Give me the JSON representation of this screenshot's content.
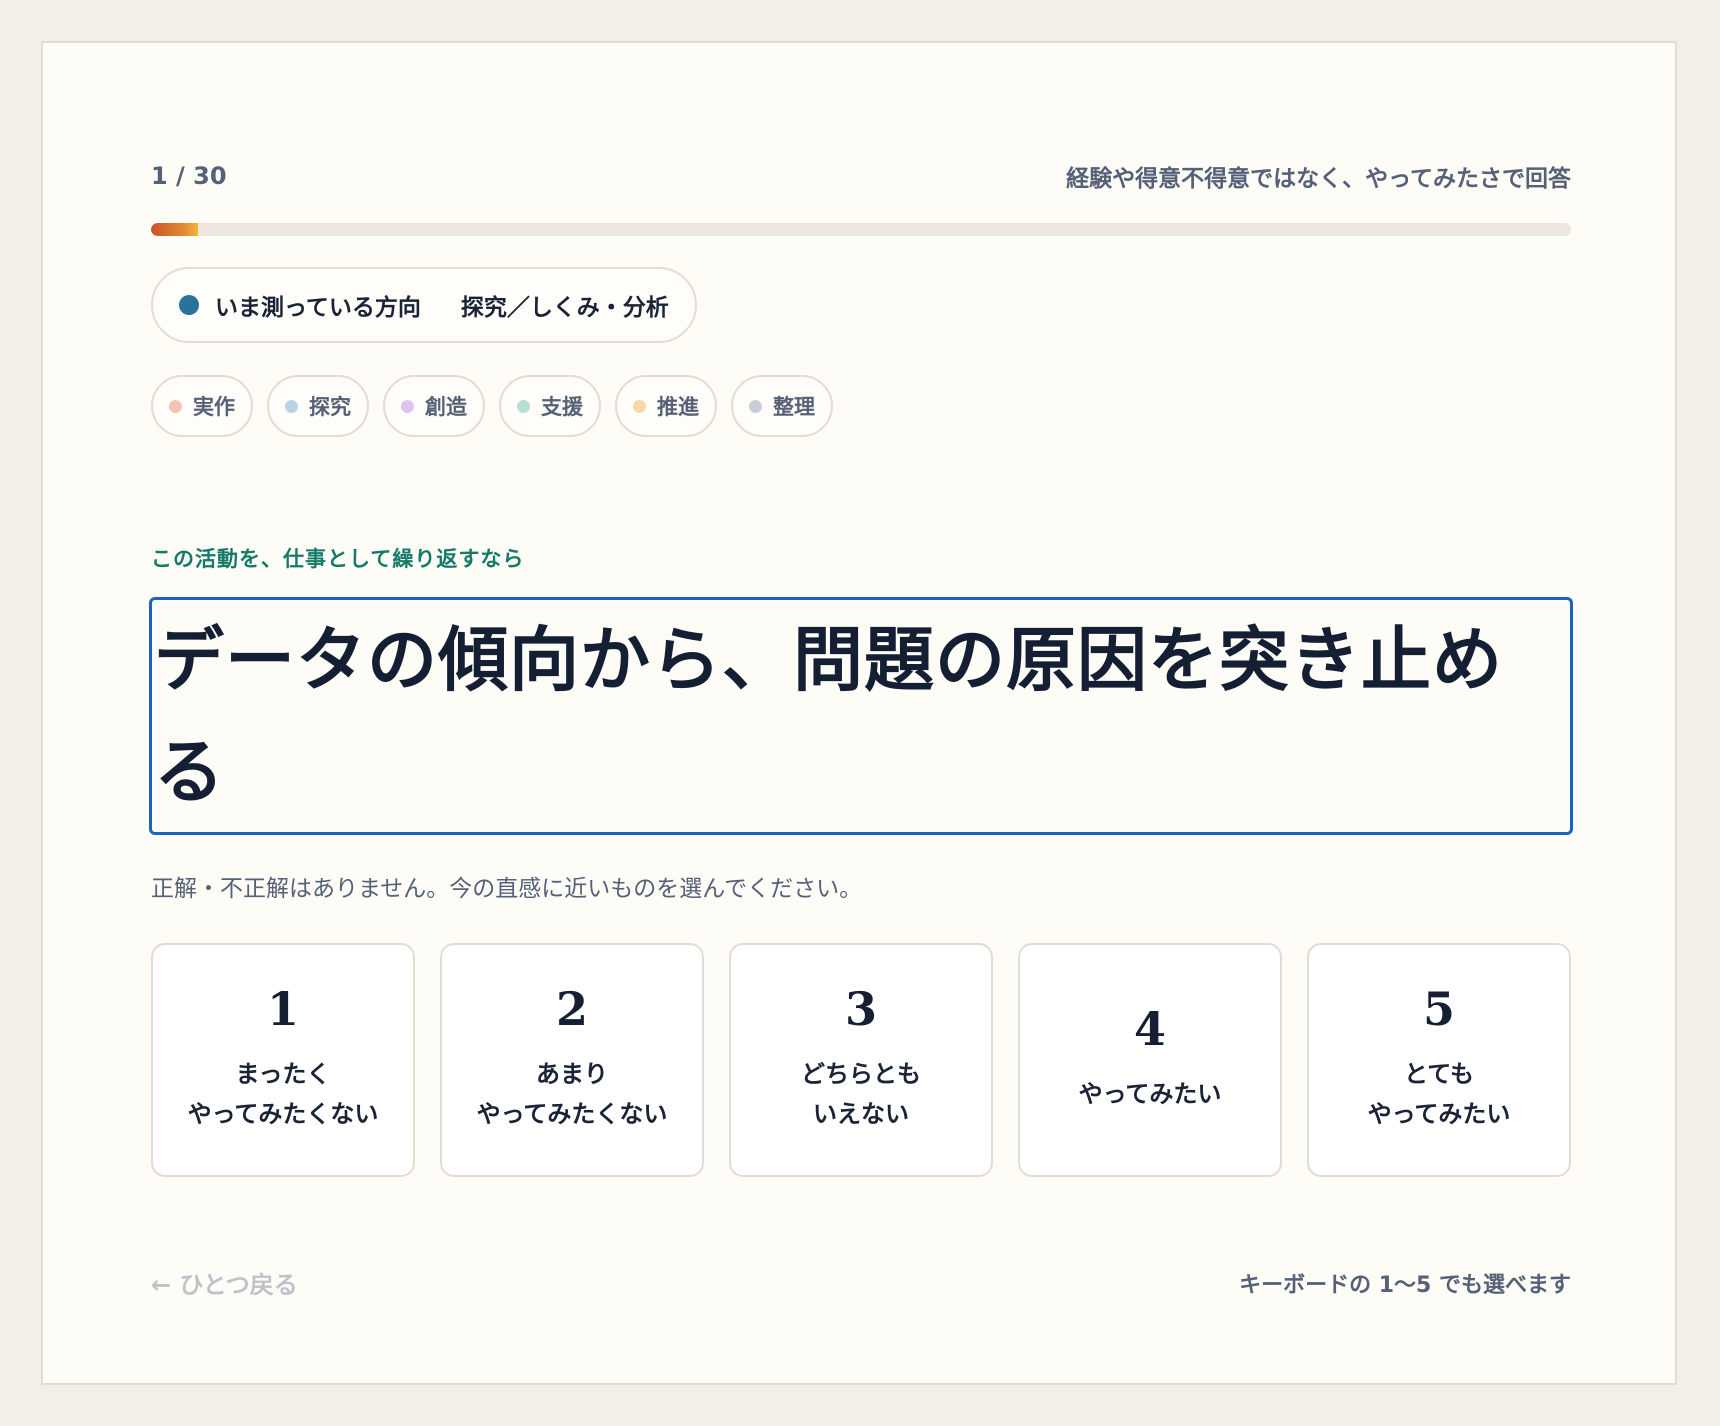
{
  "progress": {
    "counter": "1 / 30",
    "instruction": "経験や得意不得意ではなく、やってみたさで回答",
    "fraction": 0.0333
  },
  "direction": {
    "label": "いま測っている方向",
    "value": "探究／しくみ・分析",
    "color": "#2a7299"
  },
  "categories": [
    {
      "label": "実作",
      "color": "#f4c3b6"
    },
    {
      "label": "探究",
      "color": "#b9d3e2"
    },
    {
      "label": "創造",
      "color": "#dcc6f0"
    },
    {
      "label": "支援",
      "color": "#b7e0d2"
    },
    {
      "label": "推進",
      "color": "#f6d9a8"
    },
    {
      "label": "整理",
      "color": "#c8cdd8"
    }
  ],
  "question": {
    "eyebrow": "この活動を、仕事として繰り返すなら",
    "text": "データの傾向から、問題の原因を突き止める",
    "note": "正解・不正解はありません。今の直感に近いものを選んでください。"
  },
  "options": [
    {
      "number": "1",
      "label": "まったく\nやってみたくない"
    },
    {
      "number": "2",
      "label": "あまり\nやってみたくない"
    },
    {
      "number": "3",
      "label": "どちらとも\nいえない"
    },
    {
      "number": "4",
      "label": "やってみたい"
    },
    {
      "number": "5",
      "label": "とても\nやってみたい"
    }
  ],
  "footer": {
    "back": "← ひとつ戻る",
    "keyboard_hint": "キーボードの 1〜5 でも選べます"
  }
}
